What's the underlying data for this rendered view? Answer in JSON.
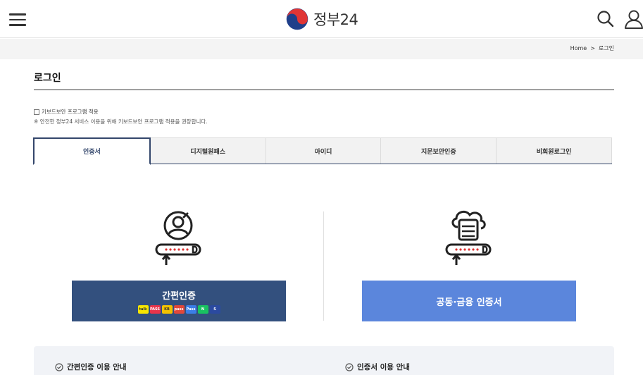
{
  "header": {
    "logo_text": "정부24",
    "menu_icon": "hamburger-menu-icon",
    "search_icon": "search-icon",
    "user_icon": "user-icon"
  },
  "breadcrumb": {
    "home": "Home",
    "separator": ">",
    "current": "로그인"
  },
  "page": {
    "title": "로그인",
    "keyboard_security_label": "키보드보안 프로그램 적용",
    "keyboard_security_checked": false,
    "keyboard_security_note": "※ 안전한 정부24 서비스 이용을 위해 키보드보안 프로그램 적용을 권장합니다."
  },
  "tabs": [
    {
      "label": "인증서",
      "active": true
    },
    {
      "label": "디지털원패스",
      "active": false
    },
    {
      "label": "아이디",
      "active": false
    },
    {
      "label": "지문보안인증",
      "active": false
    },
    {
      "label": "비회원로그인",
      "active": false
    }
  ],
  "panels": {
    "simple_auth_label": "간편인증",
    "simple_auth_providers": [
      {
        "name": "kakao",
        "text": "talk",
        "color": "#f7e600"
      },
      {
        "name": "pass",
        "text": "PASS",
        "color": "#e8344b"
      },
      {
        "name": "kb",
        "text": "KB",
        "color": "#f3c200"
      },
      {
        "name": "samsung",
        "text": "pass",
        "color": "#e2483a"
      },
      {
        "name": "payco",
        "text": "Pass",
        "color": "#3b7ee8"
      },
      {
        "name": "naver",
        "text": "N",
        "color": "#19c261"
      },
      {
        "name": "shinhan",
        "text": "S",
        "color": "#2b4aa0"
      }
    ],
    "certificate_label": "공동·금융 인증서"
  },
  "info": {
    "left": "간편인증 이용 안내",
    "right": "인증서 이용 안내",
    "icon": "check-circle-icon"
  },
  "colors": {
    "navy": "#33466b",
    "simple_btn": "#33507e",
    "cert_btn": "#5b86dc"
  }
}
